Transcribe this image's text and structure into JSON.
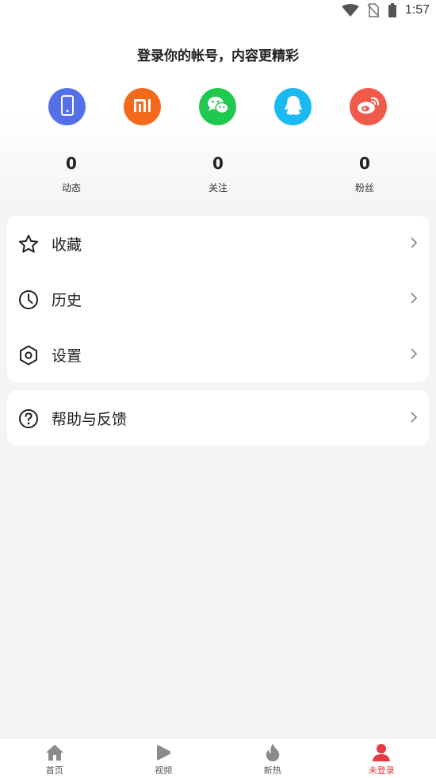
{
  "status_bar": {
    "time": "1:57"
  },
  "login": {
    "title": "登录你的帐号，内容更精彩",
    "methods": [
      {
        "icon": "phone-icon",
        "color": "#5470e8"
      },
      {
        "icon": "xiaomi-icon",
        "color": "#f46a1d"
      },
      {
        "icon": "wechat-icon",
        "color": "#1fc84f"
      },
      {
        "icon": "qq-icon",
        "color": "#1ab9f2"
      },
      {
        "icon": "weibo-icon",
        "color": "#f05a4b"
      }
    ]
  },
  "stats": [
    {
      "value": "0",
      "label": "动态"
    },
    {
      "value": "0",
      "label": "关注"
    },
    {
      "value": "0",
      "label": "粉丝"
    }
  ],
  "menu": {
    "items": [
      {
        "label": "收藏",
        "icon": "star-icon"
      },
      {
        "label": "历史",
        "icon": "clock-icon"
      },
      {
        "label": "设置",
        "icon": "settings-icon"
      }
    ],
    "help": {
      "label": "帮助与反馈",
      "icon": "help-icon"
    }
  },
  "bottom_nav": {
    "items": [
      {
        "label": "首页",
        "icon": "home-icon"
      },
      {
        "label": "视频",
        "icon": "play-icon"
      },
      {
        "label": "新热",
        "icon": "flame-icon"
      },
      {
        "label": "未登录",
        "icon": "user-icon",
        "active": true
      }
    ],
    "active_color": "#e5393f",
    "inactive_color": "#8a8a8a"
  }
}
